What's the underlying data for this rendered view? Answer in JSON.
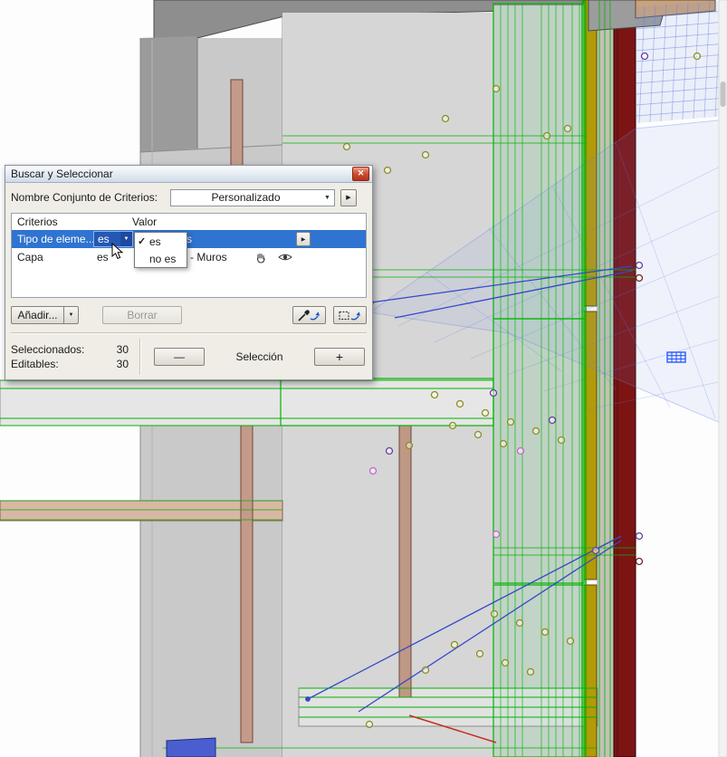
{
  "dialog": {
    "title": "Buscar y Seleccionar",
    "criteria_set": {
      "label": "Nombre Conjunto de Criterios:",
      "value": "Personalizado"
    },
    "table": {
      "headers": {
        "criteria": "Criterios",
        "value": "Valor"
      },
      "rows": [
        {
          "criteria": "Tipo de eleme...",
          "operator": "es",
          "value": "s"
        },
        {
          "criteria": "Capa",
          "operator": "es",
          "value": "- Muros"
        }
      ]
    },
    "operator_menu": {
      "items": [
        {
          "label": "es",
          "checked": true
        },
        {
          "label": "no es",
          "checked": false
        }
      ]
    },
    "buttons": {
      "add": "Añadir...",
      "delete": "Borrar"
    },
    "footer": {
      "selected_label": "Seleccionados:",
      "selected_value": "30",
      "editable_label": "Editables:",
      "editable_value": "30",
      "selection_label": "Selección",
      "minus": "—",
      "plus": "+"
    }
  },
  "icons": {
    "close": "✕",
    "dropdown": "▼",
    "flyout": "▶",
    "check": "✓"
  },
  "colors": {
    "selection_highlight": "#2f74d0",
    "wireframe_green": "#00b400",
    "wall_maroon": "#7c1414",
    "beam_yellow": "#b29a08",
    "marquee_plane_blue": "#6e8feb",
    "link_line_blue": "#3448c8"
  }
}
